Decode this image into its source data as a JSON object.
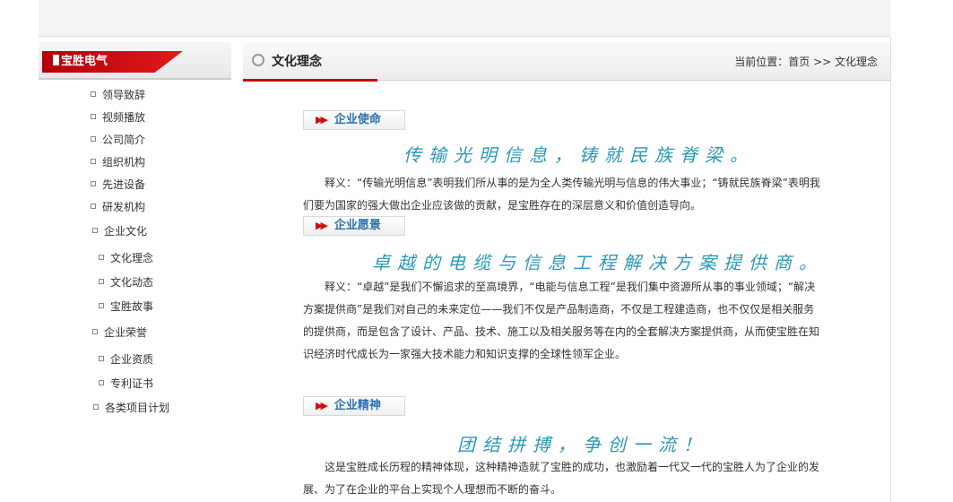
{
  "sidebar": {
    "title": "宝胜电气",
    "items": [
      {
        "label": "领导致辞"
      },
      {
        "label": "视频播放"
      },
      {
        "label": "公司简介"
      },
      {
        "label": "组织机构"
      },
      {
        "label": "先进设备"
      },
      {
        "label": "研发机构"
      },
      {
        "label": "企业文化"
      },
      {
        "label": "文化理念"
      },
      {
        "label": "文化动态"
      },
      {
        "label": "宝胜故事"
      },
      {
        "label": "企业荣誉"
      },
      {
        "label": "企业资质"
      },
      {
        "label": "专利证书"
      },
      {
        "label": "各类项目计划"
      }
    ]
  },
  "header": {
    "title": "文化理念",
    "breadcrumb": "当前位置：首页 >> 文化理念"
  },
  "sections": [
    {
      "tab": "企业使命",
      "slogan": "传输光明信息，铸就民族脊梁。",
      "text": "释义：“传输光明信息”表明我们所从事的是为全人类传输光明与信息的伟大事业；“铸就民族脊梁”表明我们要为国家的强大做出企业应该做的贡献，是宝胜存在的深层意义和价值创造导向。"
    },
    {
      "tab": "企业愿景",
      "slogan": "卓越的电缆与信息工程解决方案提供商。",
      "text": "释义：“卓越”是我们不懈追求的至高境界，“电能与信息工程”是我们集中资源所从事的事业领域；“解决方案提供商”是我们对自己的未来定位——我们不仅是产品制造商，不仅是工程建造商，也不仅仅是相关服务的提供商，而是包含了设计、产品、技术、施工以及相关服务等在内的全套解决方案提供商，从而使宝胜在知识经济时代成长为一家强大技术能力和知识支撑的全球性领军企业。"
    },
    {
      "tab": "企业精神",
      "slogan": "团结拼搏，争创一流！",
      "text": "这是宝胜成长历程的精神体现，这种精神造就了宝胜的成功，也激励着一代又一代的宝胜人为了企业的发展、为了在企业的平台上实现个人理想而不断的奋斗。"
    }
  ]
}
